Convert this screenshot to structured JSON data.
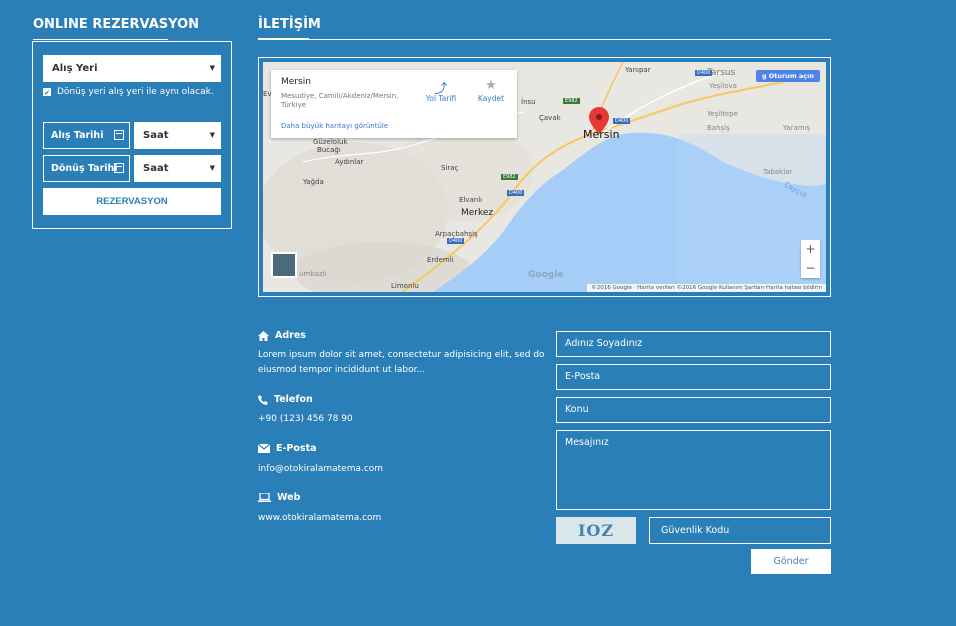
{
  "reservation": {
    "title": "ONLINE REZERVASYON",
    "pickup_placeholder": "Alış Yeri",
    "same_location_label": "Dönüş yeri alış yeri ile aynı olacak.",
    "pickup_date_label": "Alış Tarihi",
    "return_date_label": "Dönüş Tarihi",
    "pickup_time": "Saat",
    "return_time": "Saat",
    "submit_label": "REZERVASYON"
  },
  "contact": {
    "title": "İLETİŞİM"
  },
  "map": {
    "place_name": "Mersin",
    "address": "Mesudiye, Camili/Akdeniz/Mersin, Türkiye",
    "bigger_map_link": "Daha büyük haritayı görüntüle",
    "directions_label": "Yol Tarifi",
    "save_label": "Kaydet",
    "signin_label": "Oturum açın",
    "zoom_in": "+",
    "zoom_out": "−",
    "google_logo": "Google",
    "attribution": "©2016 Google · Harita verileri ©2016 Google    Kullanım Şartları    Harita hatası bildirin",
    "labels": {
      "yanipar": "Yanıpar",
      "tarsus": "Tarsus",
      "yesilova": "Yeşilova",
      "yesiltepe": "Yeşiltepe",
      "bahsis": "Bahşiş",
      "yaramis": "Yaramış",
      "insu": "İnsu",
      "cavak": "Çavak",
      "mersin": "Mersin",
      "guzelo": "Güzeloluk",
      "bucagi": "Bucağı",
      "aydinlar": "Aydınlar",
      "sirac": "Siraç",
      "yagda": "Yağda",
      "elvanli": "Elvanlı",
      "merkez": "Merkez",
      "arpacbahsis": "Arpaçbahşiş",
      "erdemli": "Erdemli",
      "limonlu": "Limonlu",
      "tabaklar": "Tabaklar",
      "kumbazli": "umbazlı",
      "ev": "Ev",
      "caycuk": "Çayçuk",
      "e90": "E982",
      "d400a": "D400",
      "d400b": "D400",
      "e90b": "E982",
      "d400c": "D400",
      "d400d": "D400"
    }
  },
  "info": {
    "address_title": "Adres",
    "address_text": "Lorem ipsum dolor sit amet, consectetur adipisicing elit, sed do eiusmod tempor incididunt ut labor...",
    "phone_title": "Telefon",
    "phone_text": "+90 (123) 456 78 90",
    "email_title": "E-Posta",
    "email_text": "info@otokiralamatema.com",
    "web_title": "Web",
    "web_text": "www.otokiralamatema.com"
  },
  "form": {
    "name_placeholder": "Adınız Soyadınız",
    "email_placeholder": "E-Posta",
    "subject_placeholder": "Konu",
    "message_placeholder": "Mesajınız",
    "captcha_text": "IOZ",
    "security_placeholder": "Güvenlik Kodu",
    "send_label": "Gönder"
  },
  "colors": {
    "background": "#2a7fb8",
    "sea": "#a5cdf7",
    "land": "#e9e7e1",
    "marker": "#e53935"
  }
}
